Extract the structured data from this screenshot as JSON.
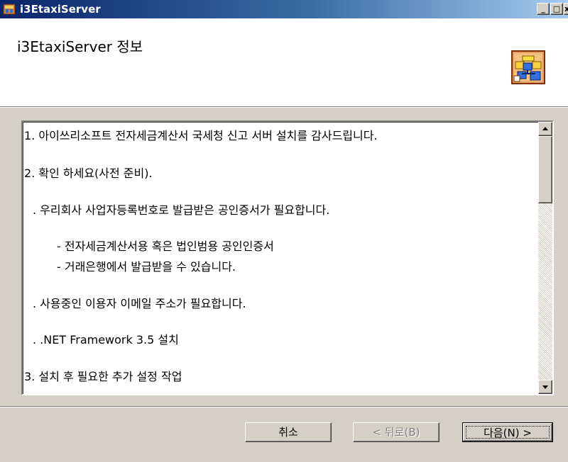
{
  "window": {
    "title": "i3EtaxiServer",
    "controls": {
      "minimize": "_",
      "maximize": "□",
      "close": "x"
    }
  },
  "header": {
    "heading": "i3EtaxiServer 정보",
    "logo_icon": "installer-network-icon"
  },
  "content": {
    "lines": [
      "1. 아이쓰리소프트 전자세금계산서 국세청 신고 서버 설치를 감사드립니다.",
      "2. 확인 하세요(사전 준비).",
      ". 우리회사 사업자등록번호로 발급받은 공인증서가 필요합니다.",
      "- 전자세금계산서용 혹은 법인범용 공인인증서",
      "- 거래은행에서 발급받을 수 있습니다.",
      ". 사용중인 이용자 이메일 주소가 필요합니다.",
      ". .NET Framework 3.5 설치",
      "3. 설치 후 필요한 추가 설정 작업"
    ]
  },
  "buttons": {
    "cancel": "취소",
    "back": "< 뒤로(B)",
    "next": "다음(N) >"
  },
  "colors": {
    "face": "#d4d0c8",
    "title_start": "#0a246a",
    "title_end": "#a6caf0"
  }
}
